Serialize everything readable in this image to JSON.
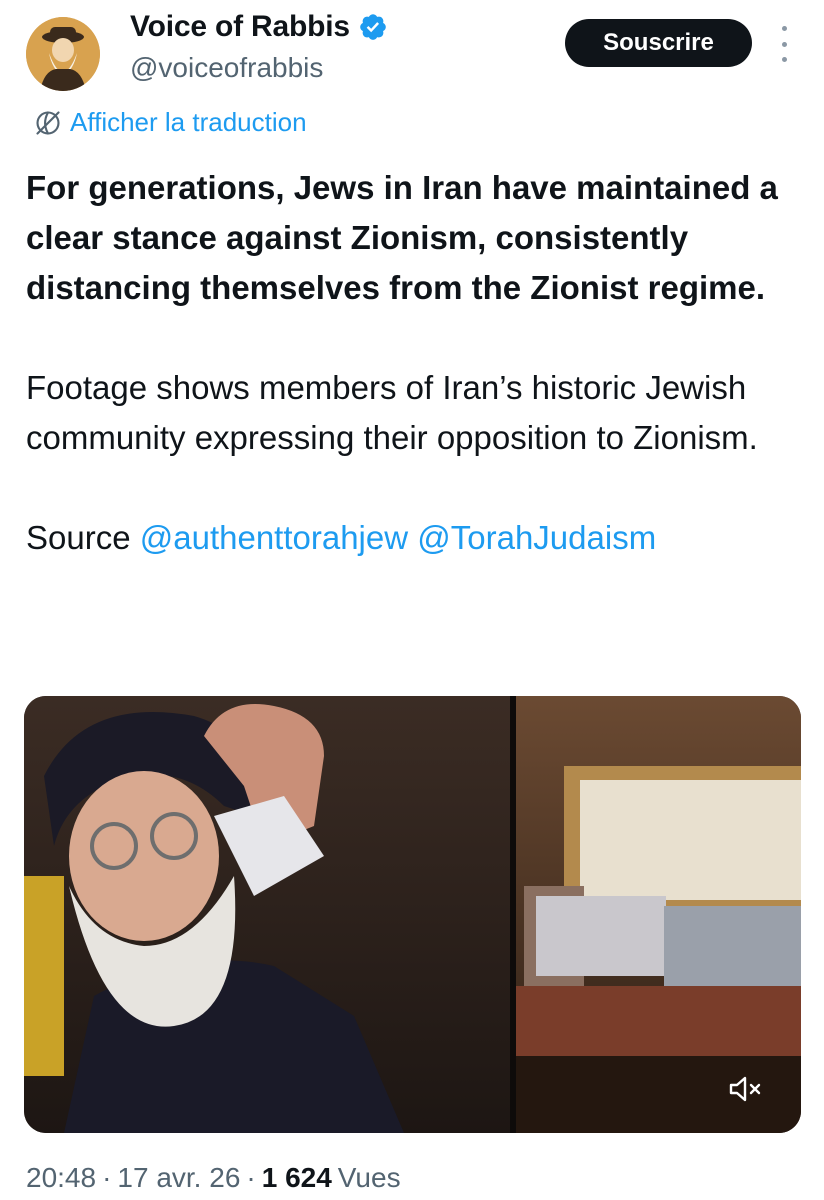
{
  "account": {
    "display_name": "Voice of Rabbis",
    "handle": "@voiceofrabbis",
    "verified": true,
    "verified_color": "#1d9bf0"
  },
  "header": {
    "subscribe_label": "Souscrire",
    "more_icon": "more-vertical-icon"
  },
  "translation": {
    "label": "Afficher la traduction",
    "icon": "globe-icon"
  },
  "tweet": {
    "bold_text": "For generations, Jews in Iran have maintained a clear stance against Zionism, consistently distancing themselves from the Zionist regime.",
    "paragraph_2": "Footage shows members of Iran’s historic Jewish community expressing their opposition to Zionism.",
    "source_label": "Source",
    "mentions": [
      "@authenttorahjew",
      "@TorahJudaism"
    ]
  },
  "media": {
    "type": "video",
    "mute_icon": "speaker-muted-icon"
  },
  "meta": {
    "time": "20:48",
    "separator": "·",
    "date": "17 avr. 26",
    "views_count": "1 624",
    "views_label": "Vues"
  },
  "colors": {
    "accent": "#1d9bf0",
    "text": "#0f1419",
    "secondary": "#536471"
  }
}
